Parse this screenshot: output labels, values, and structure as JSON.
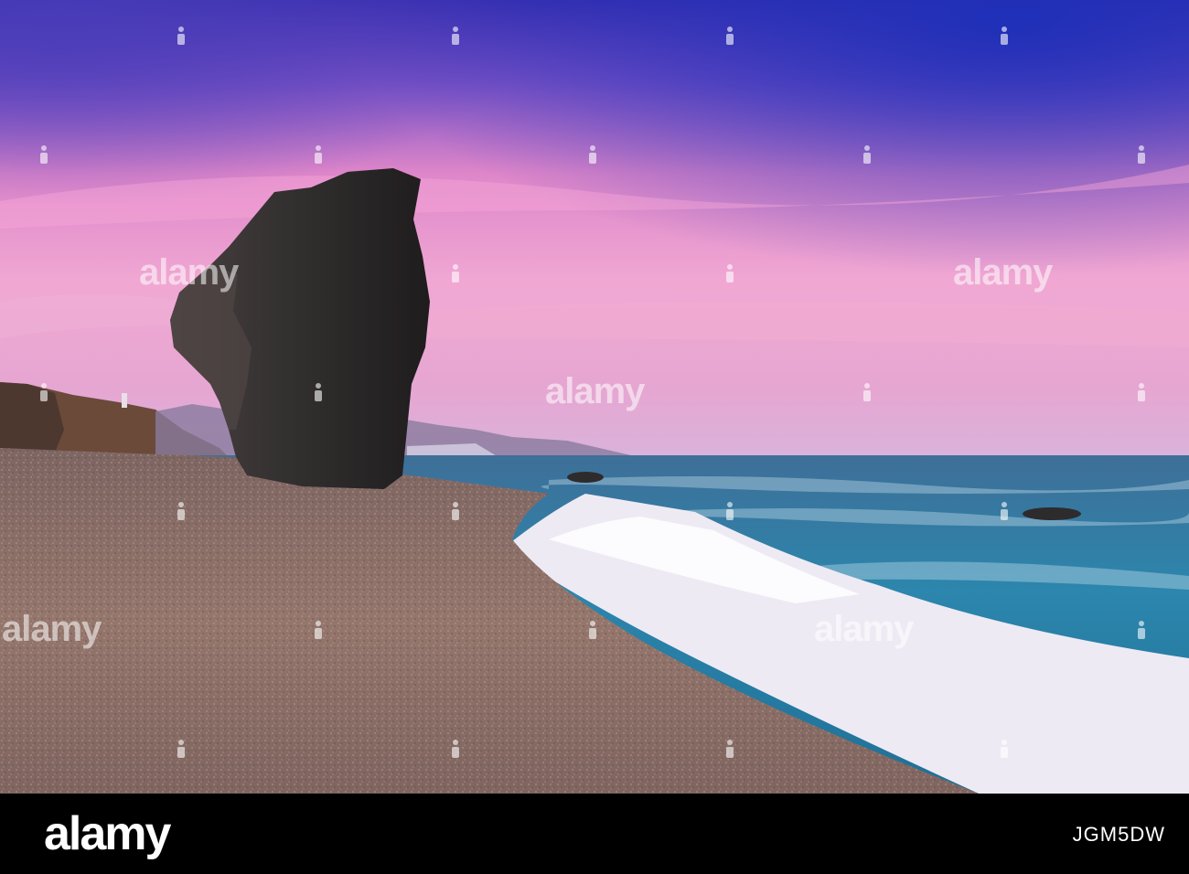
{
  "watermark": {
    "text": "alamy"
  },
  "footer": {
    "logo": "alamy",
    "image_id": "JGM5DW"
  },
  "colors": {
    "sky_top": "#2a2fb5",
    "sky_pink": "#e98fc8",
    "sky_horizon": "#f2b3d6",
    "rock": "#2e2a2b",
    "sea": "#2f7fa4",
    "foam": "#f1eef7",
    "sand": "#8f7369"
  }
}
